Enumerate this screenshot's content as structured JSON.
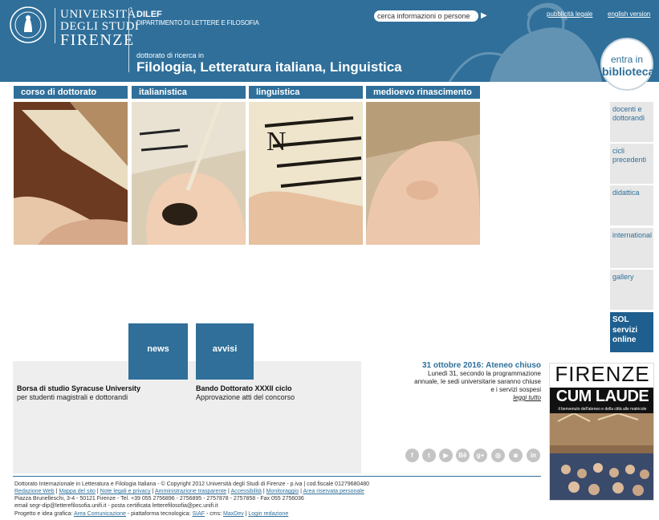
{
  "header": {
    "university": {
      "line1": "UNIVERSITÀ",
      "line2": "DEGLI STUDI",
      "line3": "FIRENZE"
    },
    "dept_short": "DILEF",
    "dept_full": "DIPARTIMENTO DI LETTERE E FILOSOFIA",
    "phd_subtitle": "dottorato di ricerca in",
    "phd_title": "Filologia, Letteratura italiana, Linguistica",
    "search_placeholder": "cerca informazioni o persone",
    "links": {
      "publicity": "pubblicità legale",
      "english": "english version"
    },
    "library": {
      "line1": "entra in",
      "line2": "biblioteca"
    }
  },
  "sections": [
    {
      "label": "corso di dottorato"
    },
    {
      "label": "italianistica"
    },
    {
      "label": "linguistica"
    },
    {
      "label": "medioevo rinascimento"
    }
  ],
  "right_nav": [
    {
      "label": "docenti e dottorandi"
    },
    {
      "label": "cicli precedenti"
    },
    {
      "label": "didattica"
    },
    {
      "label": "international"
    },
    {
      "label": "gallery"
    }
  ],
  "sol": {
    "line1": "SOL",
    "line2": "servizi",
    "line3": "online"
  },
  "news": {
    "tab": "news",
    "title": "Borsa di studio Syracuse University",
    "text": "per studenti magistrali e dottorandi"
  },
  "avvisi": {
    "tab": "avvisi",
    "title": "Bando Dottorato XXXII ciclo",
    "text": "Approvazione atti del concorso"
  },
  "alert": {
    "title": "31 ottobre 2016: Ateneo chiuso",
    "line1": "Lunedì 31, secondo la programmazione",
    "line2": "annuale, le sedi universitarie saranno chiuse",
    "line3": "e i servizi sospesi",
    "more": "leggi tutto"
  },
  "social": [
    {
      "icon": "facebook-icon",
      "glyph": "f"
    },
    {
      "icon": "twitter-icon",
      "glyph": "t"
    },
    {
      "icon": "youtube-icon",
      "glyph": "▶"
    },
    {
      "icon": "behance-icon",
      "glyph": "Bē"
    },
    {
      "icon": "googleplus-icon",
      "glyph": "g+"
    },
    {
      "icon": "foursquare-icon",
      "glyph": "◎"
    },
    {
      "icon": "instagram-icon",
      "glyph": "◙"
    },
    {
      "icon": "linkedin-icon",
      "glyph": "in"
    }
  ],
  "cum_laude": {
    "title1": "FIRENZE",
    "title2": "CUM LAUDE",
    "subtitle": "il benvenuto dell'ateneo e della città alle matricole"
  },
  "footer": {
    "line1": "Dottorato Internazionale in Letteratura e Filologia Italiana - © Copyright 2012 Università degli Studi di Firenze - p.iva | cod.fiscale 01279680480",
    "line2_links": [
      "Redazione Web",
      "Mappa del sito",
      "Note legali e privacy",
      "Amministrazione trasparente",
      "Accessibilità",
      "Monitoraggio",
      "Area riservata personale"
    ],
    "line3": "Piazza Brunelleschi, 3-4 - 50121 Firenze - Tel. +39 055 2756896 - 2756895 - 2757878 - 2757858 - Fax 055 2756036",
    "email_prefix": "email segr-dip",
    "email_domain": "letterefilosofia.unifi.it",
    "pec_prefix": "- posta certificata letterefilosofia",
    "pec_domain": "pec.unifi.it",
    "credits_prefix": "Progetto e idea grafica:",
    "credits_link1": "Area Comunicazione",
    "credits_mid": "- piattaforma tecnologica:",
    "credits_link2": "SIAF",
    "credits_cms": "- cms:",
    "credits_link3": "MaxDev",
    "credits_link4": "Login redazione"
  },
  "colors": {
    "brand": "#2f6f9a",
    "panel": "#eeeeee",
    "nav": "#e7e7e7"
  }
}
